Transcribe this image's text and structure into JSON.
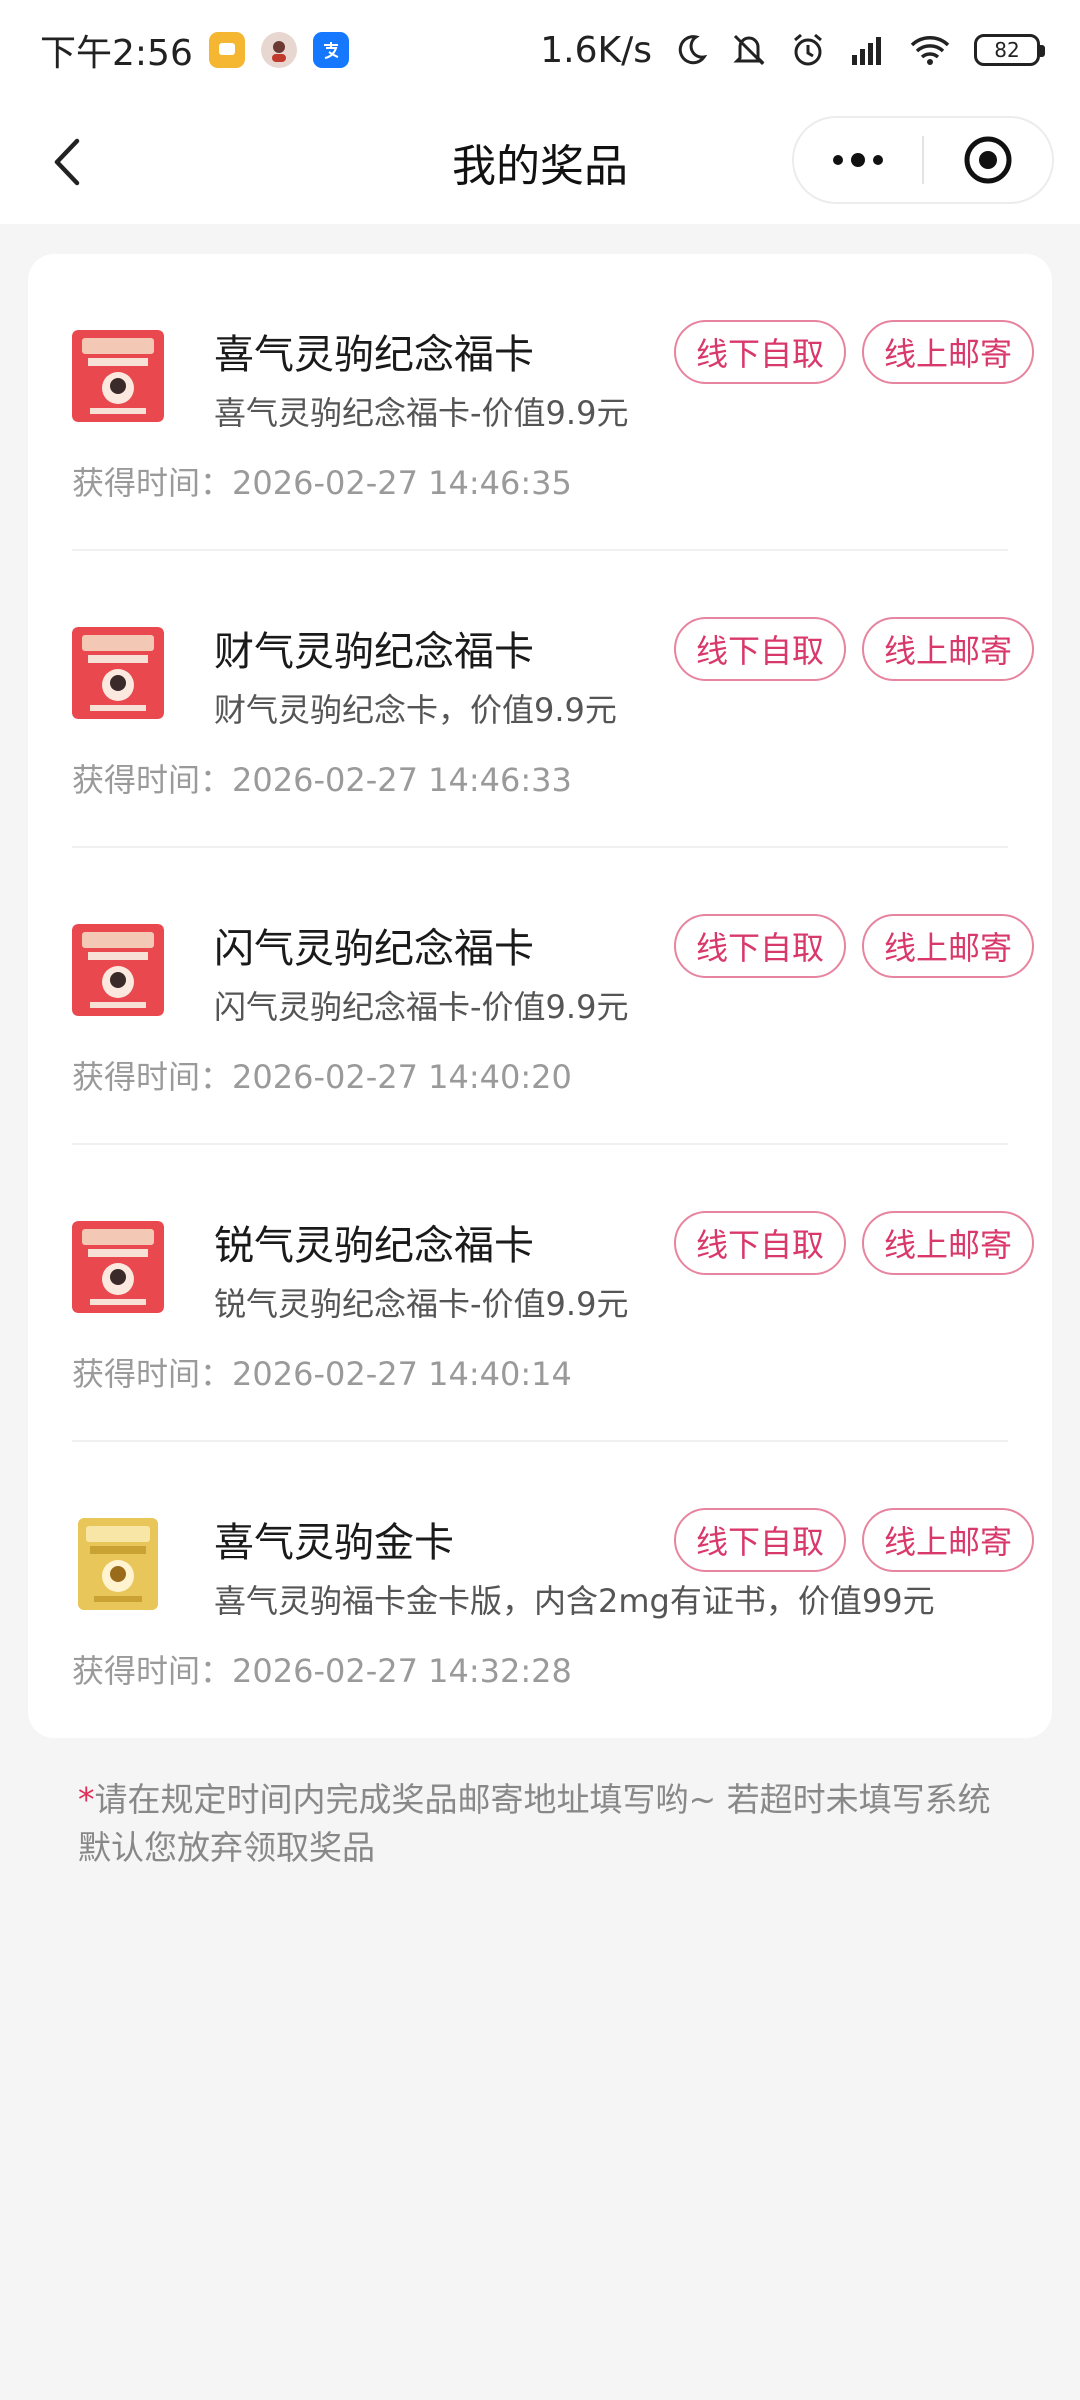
{
  "status_bar": {
    "time": "下午2:56",
    "network_speed": "1.6K/s",
    "battery": "82",
    "icons": [
      "message-app-icon",
      "avatar-app-icon",
      "alipay-app-icon",
      "moon-icon",
      "mute-icon",
      "alarm-icon",
      "signal-icon",
      "wifi-icon",
      "battery-icon"
    ]
  },
  "nav": {
    "title": "我的奖品"
  },
  "prizes": [
    {
      "name": "喜气灵驹纪念福卡",
      "desc": "喜气灵驹纪念福卡-价值9.9元",
      "time": "获得时间：2026-02-27 14:46:35",
      "thumb_color": "#e8484e",
      "offline_label": "线下自取",
      "mail_label": "线上邮寄"
    },
    {
      "name": "财气灵驹纪念福卡",
      "desc": "财气灵驹纪念卡，价值9.9元",
      "time": "获得时间：2026-02-27 14:46:33",
      "thumb_color": "#e8484e",
      "offline_label": "线下自取",
      "mail_label": "线上邮寄"
    },
    {
      "name": "闪气灵驹纪念福卡",
      "desc": "闪气灵驹纪念福卡-价值9.9元",
      "time": "获得时间：2026-02-27 14:40:20",
      "thumb_color": "#e8484e",
      "offline_label": "线下自取",
      "mail_label": "线上邮寄"
    },
    {
      "name": "锐气灵驹纪念福卡",
      "desc": "锐气灵驹纪念福卡-价值9.9元",
      "time": "获得时间：2026-02-27 14:40:14",
      "thumb_color": "#e8484e",
      "offline_label": "线下自取",
      "mail_label": "线上邮寄"
    },
    {
      "name": "喜气灵驹金卡",
      "desc": "喜气灵驹福卡金卡版，内含2mg有证书，价值99元",
      "time": "获得时间：2026-02-27 14:32:28",
      "thumb_color": "#e9c65a",
      "offline_label": "线下自取",
      "mail_label": "线上邮寄"
    }
  ],
  "notice": {
    "star": "*",
    "text": "请在规定时间内完成奖品邮寄地址填写哟~ 若超时未填写系统默认您放弃领取奖品"
  },
  "colors": {
    "accent": "#d9386b",
    "accent_border": "#e7849f",
    "background": "#f5f5f5"
  }
}
